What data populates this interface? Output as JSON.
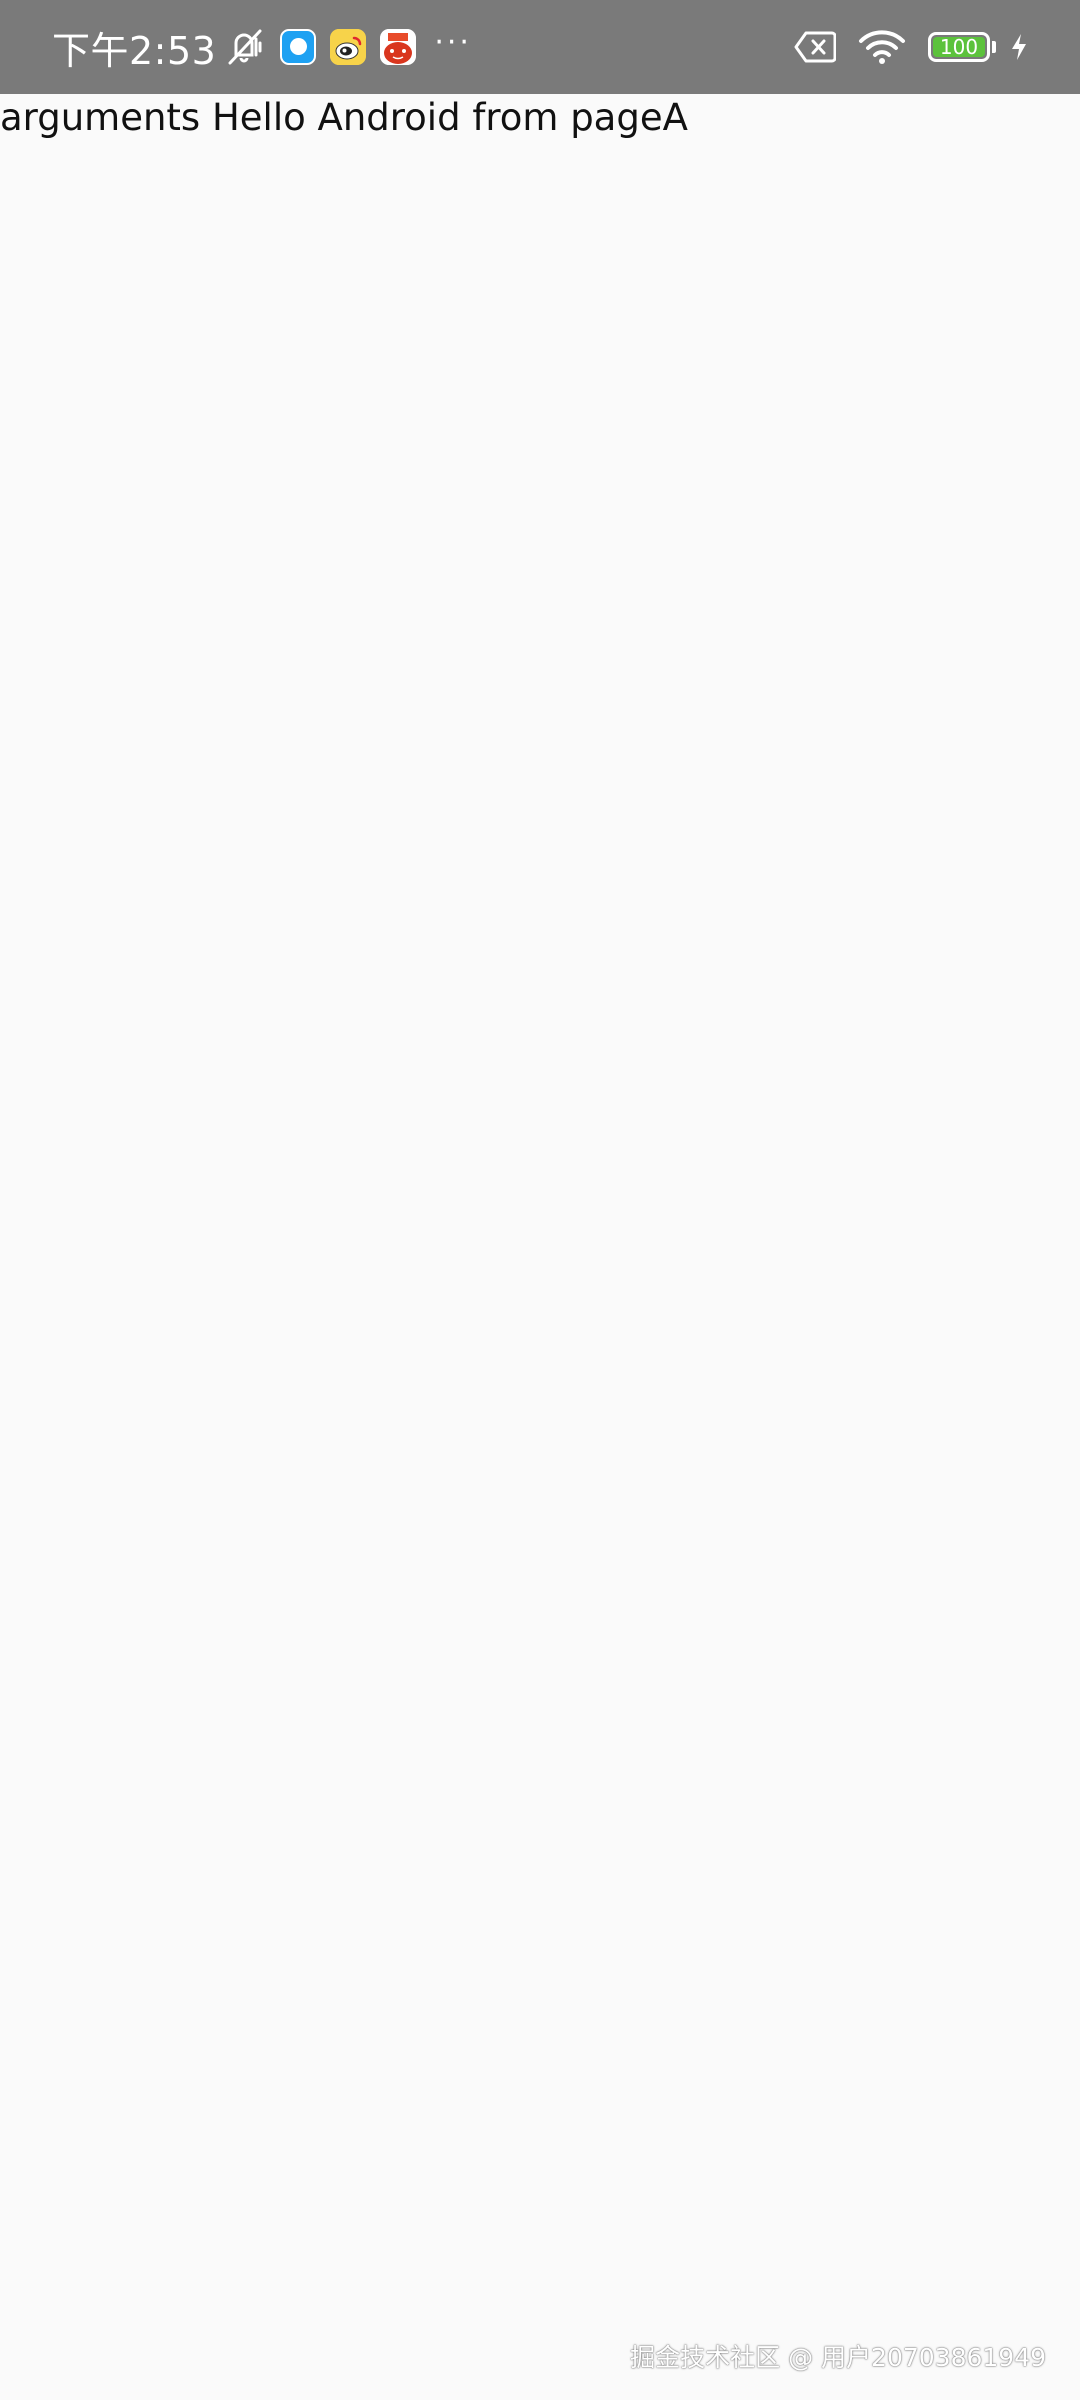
{
  "status_bar": {
    "time": "下午2:53",
    "battery_level": "100",
    "icons": {
      "mute": "mute-vibrate-icon",
      "app1": "blue-chat-app-icon",
      "app2": "weibo-app-icon",
      "app3": "red-app-icon",
      "more": "more-notifications-icon",
      "sim": "no-sim-icon",
      "wifi": "wifi-icon",
      "battery": "battery-icon",
      "charging": "charging-bolt-icon"
    },
    "more_glyph": "···",
    "colors": {
      "background": "#7a7a7a",
      "battery_fill": "#5cc23c"
    }
  },
  "page": {
    "text": "arguments Hello Android from pageA",
    "background": "#fafafa"
  },
  "watermark": {
    "text": "掘金技术社区 @ 用户20703861949"
  }
}
